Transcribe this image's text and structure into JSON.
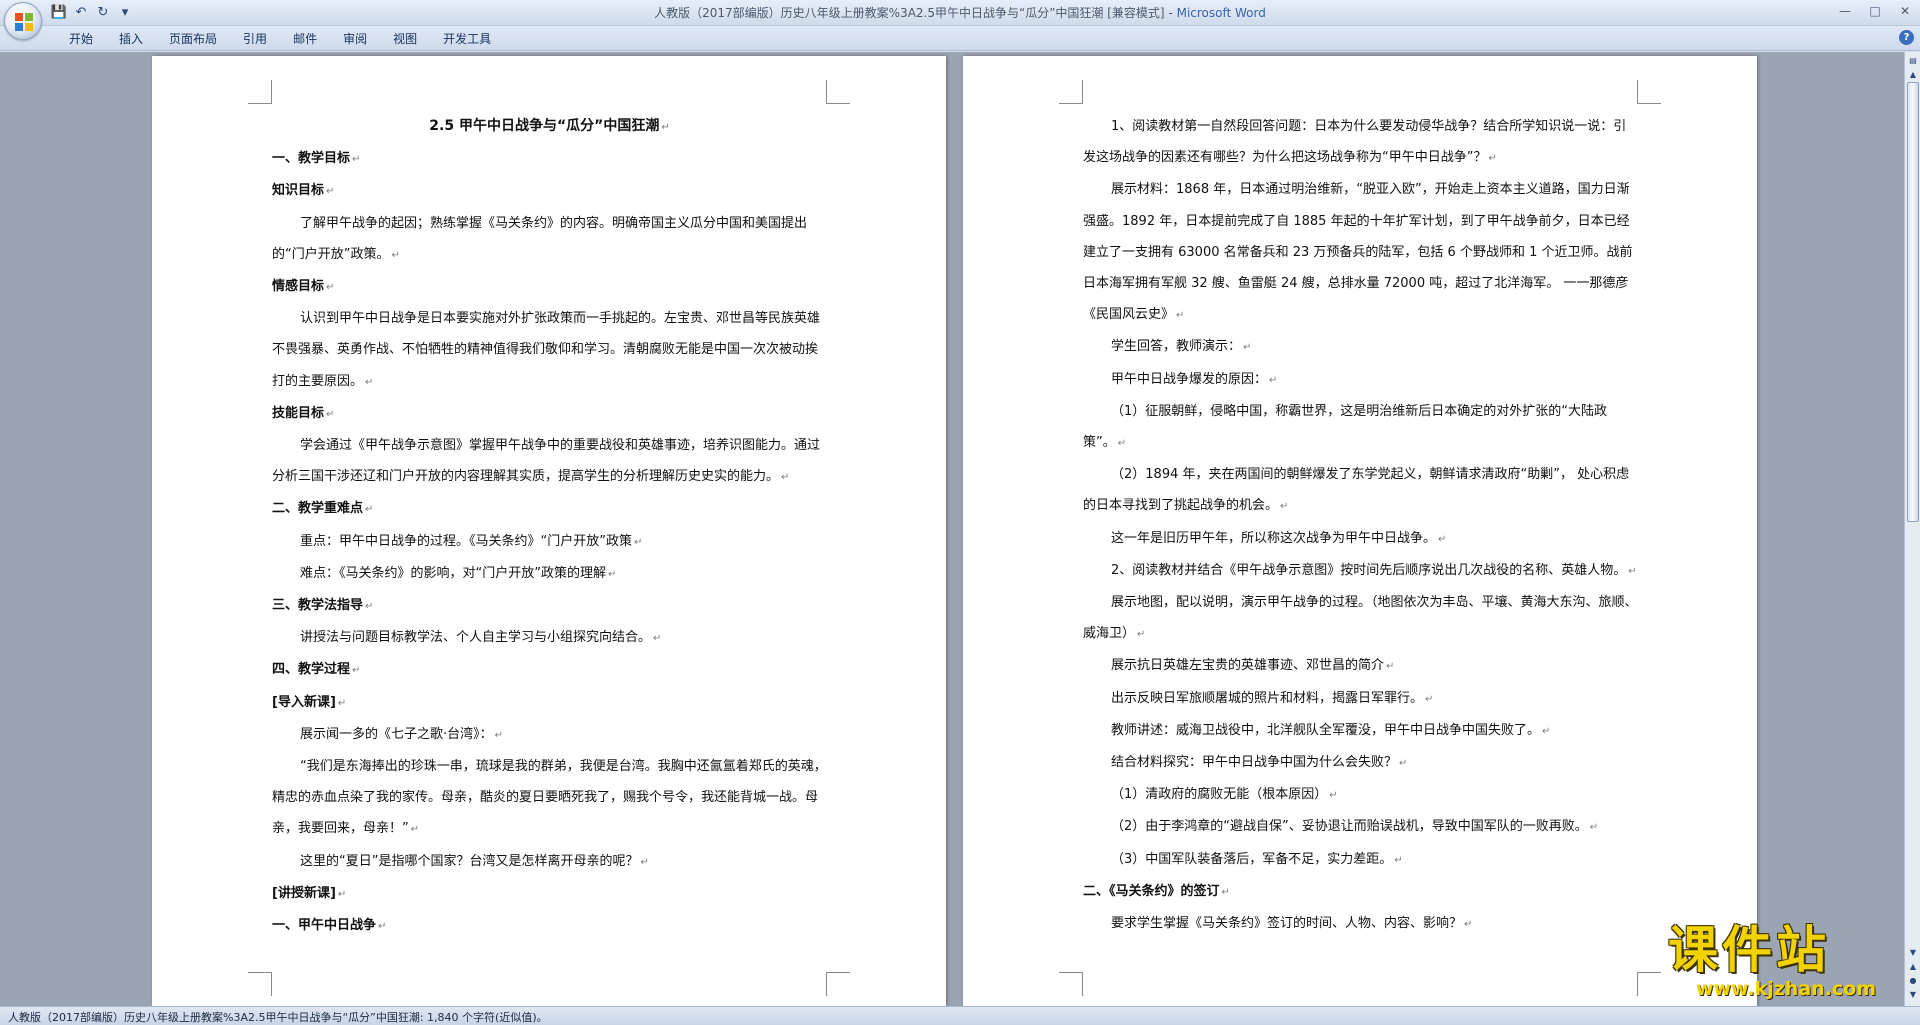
{
  "window": {
    "title": "人教版（2017部编版）历史八年级上册教案%3A2.5甲午中日战争与“瓜分”中国狂潮 [兼容模式]",
    "app_name": "Microsoft Word"
  },
  "ribbon": {
    "tabs": [
      "开始",
      "插入",
      "页面布局",
      "引用",
      "邮件",
      "审阅",
      "视图",
      "开发工具"
    ]
  },
  "status_bar": {
    "text": "人教版（2017部编版）历史八年级上册教案%3A2.5甲午中日战争与“瓜分”中国狂潮: 1,840 个字符(近似值)。"
  },
  "watermark": {
    "cn": "课件站",
    "url": "www.kjzhan.com"
  },
  "page_left": {
    "title": "2.5  甲午中日战争与“瓜分”中国狂潮",
    "paragraphs": [
      {
        "text": "一、教学目标",
        "style": "b"
      },
      {
        "text": "知识目标",
        "style": "b"
      },
      {
        "text": "了解甲午战争的起因；熟练掌握《马关条约》的内容。明确帝国主义瓜分中国和美国提出的“门户开放”政策。",
        "style": "ind"
      },
      {
        "text": "情感目标",
        "style": "b"
      },
      {
        "text": "认识到甲午中日战争是日本要实施对外扩张政策而一手挑起的。左宝贵、邓世昌等民族英雄不畏强暴、英勇作战、不怕牺牲的精神值得我们敬仰和学习。清朝腐败无能是中国一次次被动挨打的主要原因。",
        "style": "ind"
      },
      {
        "text": "技能目标",
        "style": "b"
      },
      {
        "text": "学会通过《甲午战争示意图》掌握甲午战争中的重要战役和英雄事迹，培养识图能力。通过分析三国干涉还辽和门户开放的内容理解其实质，提高学生的分析理解历史史实的能力。",
        "style": "ind"
      },
      {
        "text": "二、教学重难点",
        "style": "b"
      },
      {
        "text": "重点：甲午中日战争的过程。《马关条约》“门户开放”政策",
        "style": "ind"
      },
      {
        "text": "难点：《马关条约》的影响，对“门户开放”政策的理解",
        "style": "ind"
      },
      {
        "text": "三、教学法指导",
        "style": "b"
      },
      {
        "text": "讲授法与问题目标教学法、个人自主学习与小组探究向结合。",
        "style": "ind"
      },
      {
        "text": "四、教学过程",
        "style": "b"
      },
      {
        "text": "[导入新课]",
        "style": "b"
      },
      {
        "text": "展示闻一多的《七子之歌·台湾》：",
        "style": "ind"
      },
      {
        "text": "“我们是东海捧出的珍珠一串，琉球是我的群弟，我便是台湾。我胸中还氤氲着郑氏的英魂，精忠的赤血点染了我的家传。母亲，酷炎的夏日要晒死我了，赐我个号令，我还能背城一战。母亲，我要回来，母亲！”",
        "style": "ind"
      },
      {
        "text": "这里的“夏日”是指哪个国家？台湾又是怎样离开母亲的呢？",
        "style": "ind"
      },
      {
        "text": "[讲授新课]",
        "style": "b"
      },
      {
        "text": "一、甲午中日战争",
        "style": "b"
      }
    ]
  },
  "page_right": {
    "paragraphs": [
      {
        "text": "1、阅读教材第一自然段回答问题：日本为什么要发动侵华战争？结合所学知识说一说：引发这场战争的因素还有哪些？为什么把这场战争称为“甲午中日战争”？",
        "style": "ind"
      },
      {
        "text": "展示材料：1868 年，日本通过明治维新，“脱亚入欧”，开始走上资本主义道路，国力日渐强盛。1892 年，日本提前完成了自 1885 年起的十年扩军计划，到了甲午战争前夕，日本已经建立了一支拥有 63000 名常备兵和 23 万预备兵的陆军，包括 6 个野战师和 1 个近卫师。战前日本海军拥有军舰 32 艘、鱼雷艇 24 艘，总排水量 72000 吨，超过了北洋海军。 一一那德彦《民国风云史》",
        "style": "ind"
      },
      {
        "text": "学生回答，教师演示：",
        "style": "ind"
      },
      {
        "text": "甲午中日战争爆发的原因：",
        "style": "ind"
      },
      {
        "text": "（1）征服朝鲜，侵略中国，称霸世界，这是明治维新后日本确定的对外扩张的“大陆政策”。",
        "style": "ind"
      },
      {
        "text": "（2）1894 年，夹在两国间的朝鲜爆发了东学党起义，朝鲜请求清政府“助剿”， 处心积虑的日本寻找到了挑起战争的机会。",
        "style": "ind"
      },
      {
        "text": "这一年是旧历甲午年，所以称这次战争为甲午中日战争。",
        "style": "ind"
      },
      {
        "text": "2、阅读教材并结合《甲午战争示意图》按时间先后顺序说出几次战役的名称、英雄人物。",
        "style": "ind"
      },
      {
        "text": "展示地图，配以说明，演示甲午战争的过程。（地图依次为丰岛、平壤、黄海大东沟、旅顺、威海卫）",
        "style": "ind"
      },
      {
        "text": "展示抗日英雄左宝贵的英雄事迹、邓世昌的简介",
        "style": "ind"
      },
      {
        "text": "出示反映日军旅顺屠城的照片和材料，揭露日军罪行。",
        "style": "ind"
      },
      {
        "text": "教师讲述：威海卫战役中，北洋舰队全军覆没，甲午中日战争中国失败了。",
        "style": "ind"
      },
      {
        "text": "结合材料探究：甲午中日战争中国为什么会失败？",
        "style": "ind"
      },
      {
        "text": "（1）清政府的腐败无能（根本原因）",
        "style": "ind"
      },
      {
        "text": "（2）由于李鸿章的“避战自保”、妥协退让而贻误战机，导致中国军队的一败再败。",
        "style": "ind"
      },
      {
        "text": "（3）中国军队装备落后，军备不足，实力差距。",
        "style": "ind"
      },
      {
        "text": "二、《马关条约》的签订",
        "style": "b"
      },
      {
        "text": "要求学生掌握《马关条约》签订的时间、人物、内容、影响？",
        "style": "ind"
      }
    ]
  }
}
